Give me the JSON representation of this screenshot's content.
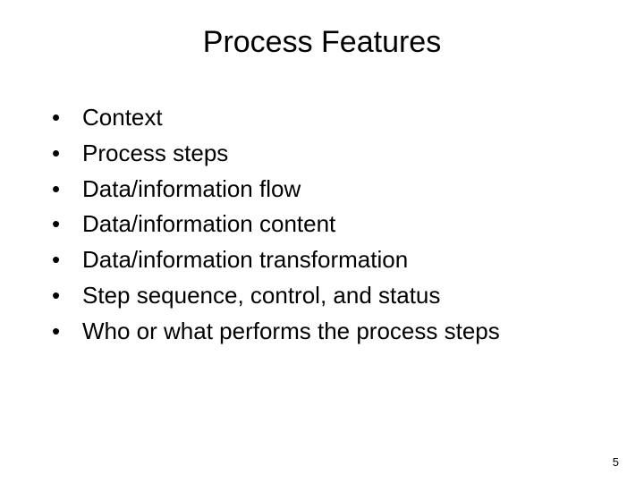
{
  "slide": {
    "title": "Process Features",
    "bullets": [
      "Context",
      "Process steps",
      "Data/information flow",
      "Data/information content",
      "Data/information transformation",
      "Step sequence, control, and status",
      "Who or what performs the process steps"
    ],
    "page_number": "5"
  }
}
